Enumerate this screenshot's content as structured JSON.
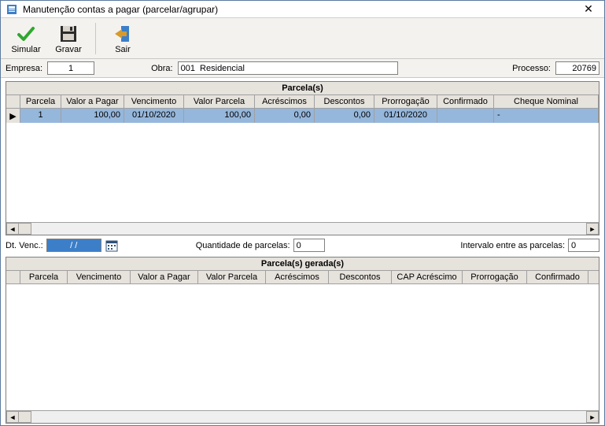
{
  "window": {
    "title": "Manutenção contas a pagar (parcelar/agrupar)"
  },
  "toolbar": {
    "simular": "Simular",
    "gravar": "Gravar",
    "sair": "Sair"
  },
  "filters": {
    "empresa_label": "Empresa:",
    "empresa_value": "1",
    "obra_label": "Obra:",
    "obra_value": "001  Residencial",
    "processo_label": "Processo:",
    "processo_value": "20769"
  },
  "grid1": {
    "title": "Parcela(s)",
    "headers": [
      "Parcela",
      "Valor a Pagar",
      "Vencimento",
      "Valor Parcela",
      "Acréscimos",
      "Descontos",
      "Prorrogação",
      "Confirmado",
      "Cheque Nominal"
    ],
    "rows": [
      {
        "parcela": "1",
        "valor_pagar": "100,00",
        "vencimento": "01/10/2020",
        "valor_parcela": "100,00",
        "acrescimos": "0,00",
        "descontos": "0,00",
        "prorrogacao": "01/10/2020",
        "confirmado": "",
        "cheque": "-"
      }
    ]
  },
  "mid": {
    "dtvenc_label": "Dt. Venc.:",
    "dtvenc_value": "  /  /    ",
    "qtde_label": "Quantidade de parcelas:",
    "qtde_value": "0",
    "intervalo_label": "Intervalo entre as parcelas:",
    "intervalo_value": "0"
  },
  "grid2": {
    "title": "Parcela(s) gerada(s)",
    "headers": [
      "Parcela",
      "Vencimento",
      "Valor a Pagar",
      "Valor Parcela",
      "Acréscimos",
      "Descontos",
      "CAP Acréscimo",
      "Prorrogação",
      "Confirmado"
    ]
  }
}
